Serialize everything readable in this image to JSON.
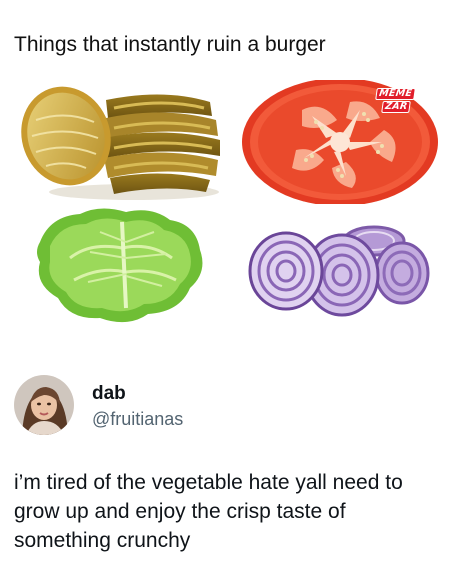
{
  "meme": {
    "title": "Things that instantly ruin a burger",
    "watermark_line1": "MEME",
    "watermark_line2": "ZAR",
    "items": [
      {
        "name": "pickles"
      },
      {
        "name": "tomato"
      },
      {
        "name": "lettuce"
      },
      {
        "name": "red onion"
      }
    ]
  },
  "tweet": {
    "display_name": "dab",
    "handle": "@fruitianas",
    "text": "i’m tired of the vegetable hate yall need to grow up and enjoy the crisp taste of something crunchy"
  },
  "colors": {
    "text": "#0f1419",
    "handle": "#536471",
    "watermark": "#e11d2a",
    "pickle": "#c9a63a",
    "tomato": "#e8442a",
    "lettuce": "#7cc441",
    "onion": "#8e6ab8"
  }
}
